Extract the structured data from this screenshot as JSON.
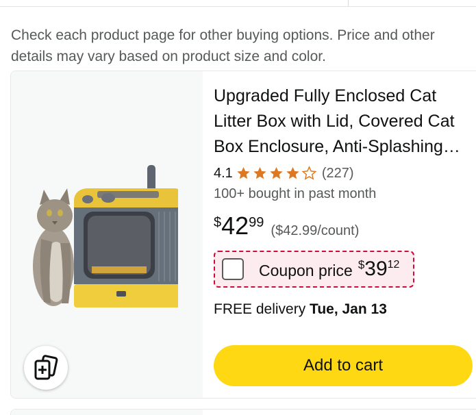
{
  "disclaimer": "Check each product page for other buying options. Price and other details may vary based on product size and color.",
  "product": {
    "title": "Upgraded Fully Enclosed Cat Litter Box with Lid, Covered Cat Box Enclosure, Anti-Splashing Cat Litter Box",
    "rating": "4.1",
    "rating_value": 4.1,
    "rating_max": 5,
    "reviews": "(227)",
    "bought": "100+ bought in past month",
    "price": {
      "symbol": "$",
      "whole": "42",
      "fraction": "99"
    },
    "unit_price": "($42.99/count)",
    "coupon": {
      "label": "Coupon price",
      "symbol": "$",
      "whole": "39",
      "fraction": "12"
    },
    "delivery": {
      "prefix": "FREE delivery",
      "date": "Tue, Jan 13"
    },
    "add_to_cart_label": "Add to cart",
    "compare_icon": "compare-add-icon",
    "image_icon": "cat-litter-box-image"
  },
  "colors": {
    "star": "#de7921",
    "button": "#ffd814",
    "coupon_border": "#cc0c39",
    "coupon_bg": "#fdecef",
    "muted_text": "#565959"
  }
}
